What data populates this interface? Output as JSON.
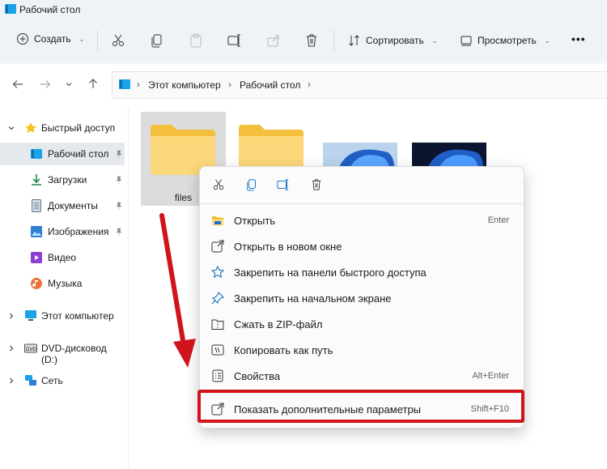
{
  "window": {
    "title": "Рабочий стол"
  },
  "toolbar": {
    "create_label": "Создать",
    "sort_label": "Сортировать",
    "view_label": "Просмотреть",
    "more_label": "•••"
  },
  "address": {
    "crumbs": [
      "Этот компьютер",
      "Рабочий стол"
    ],
    "separator": "›"
  },
  "sidebar": {
    "quick_access": "Быстрый доступ",
    "items": [
      {
        "label": "Рабочий стол",
        "icon": "desktop-icon"
      },
      {
        "label": "Загрузки",
        "icon": "download-icon"
      },
      {
        "label": "Документы",
        "icon": "document-icon"
      },
      {
        "label": "Изображения",
        "icon": "image-icon"
      },
      {
        "label": "Видео",
        "icon": "video-icon"
      },
      {
        "label": "Музыка",
        "icon": "music-icon"
      }
    ],
    "this_pc": "Этот компьютер",
    "dvd": "DVD-дисковод (D:)",
    "network": "Сеть"
  },
  "files": [
    {
      "name": "files",
      "type": "folder"
    },
    {
      "name": "",
      "type": "folder"
    },
    {
      "name": "",
      "type": "image"
    },
    {
      "name": "",
      "type": "image"
    }
  ],
  "context_menu": {
    "quick_actions": [
      "cut-icon",
      "copy-icon",
      "rename-icon",
      "delete-icon"
    ],
    "items": [
      {
        "label": "Открыть",
        "shortcut": "Enter",
        "icon": "folder-open-icon"
      },
      {
        "label": "Открыть в новом окне",
        "shortcut": "",
        "icon": "new-window-icon"
      },
      {
        "label": "Закрепить на панели быстрого доступа",
        "shortcut": "",
        "icon": "star-pin-icon"
      },
      {
        "label": "Закрепить на начальном экране",
        "shortcut": "",
        "icon": "pin-icon"
      },
      {
        "label": "Сжать в ZIP-файл",
        "shortcut": "",
        "icon": "zip-icon"
      },
      {
        "label": "Копировать как путь",
        "shortcut": "",
        "icon": "copy-path-icon"
      },
      {
        "label": "Свойства",
        "shortcut": "Alt+Enter",
        "icon": "properties-icon"
      }
    ],
    "more": {
      "label": "Показать дополнительные параметры",
      "shortcut": "Shift+F10",
      "icon": "show-more-icon"
    }
  },
  "colors": {
    "highlight": "#d0141c",
    "arrow": "#d0141c",
    "accent": "#0067c0"
  }
}
